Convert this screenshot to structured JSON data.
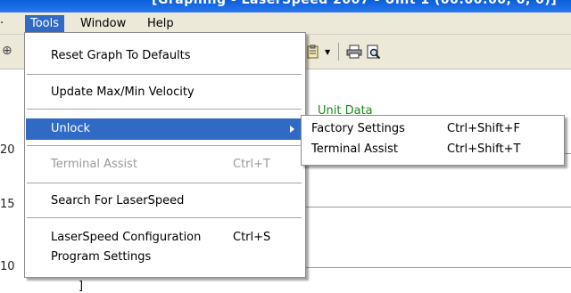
{
  "window": {
    "title": "[Graphing - LaserSpeed 2007 - Unit 1 (00:00:00, 0, 0)]"
  },
  "menubar": {
    "cut_item": "",
    "items": [
      {
        "label": "Tools"
      },
      {
        "label": "Window"
      },
      {
        "label": "Help"
      }
    ]
  },
  "background": {
    "y_labels": [
      "20",
      "15",
      "10"
    ],
    "unit_data_label": "Unit Data",
    "bracket": "]"
  },
  "tools_menu": {
    "items": [
      {
        "label": "Reset Graph To Defaults",
        "shortcut": ""
      },
      {
        "label": "Update Max/Min Velocity",
        "shortcut": ""
      },
      {
        "label": "Unlock",
        "shortcut": ""
      },
      {
        "label": "Terminal Assist",
        "shortcut": "Ctrl+T"
      },
      {
        "label": "Search For LaserSpeed",
        "shortcut": ""
      },
      {
        "label": "LaserSpeed Configuration",
        "shortcut": "Ctrl+S"
      },
      {
        "label": "Program Settings",
        "shortcut": ""
      }
    ],
    "highlighted": "Unlock",
    "disabled": [
      "Terminal Assist"
    ]
  },
  "unlock_submenu": {
    "items": [
      {
        "label": "Factory Settings",
        "shortcut": "Ctrl+Shift+F"
      },
      {
        "label": "Terminal Assist",
        "shortcut": "Ctrl+Shift+T"
      }
    ]
  },
  "colors": {
    "highlight": "#316ac5",
    "menu_bar": "#ece9d8",
    "title_bar": "#0a5fd8",
    "disabled_text": "#9a9a9a",
    "unit_data_green": "#1b8a1b"
  },
  "icons": [
    "toolbar-clipboard-icon",
    "dropdown-arrow-icon",
    "print-icon",
    "print-preview-icon",
    "submenu-arrow-icon"
  ]
}
